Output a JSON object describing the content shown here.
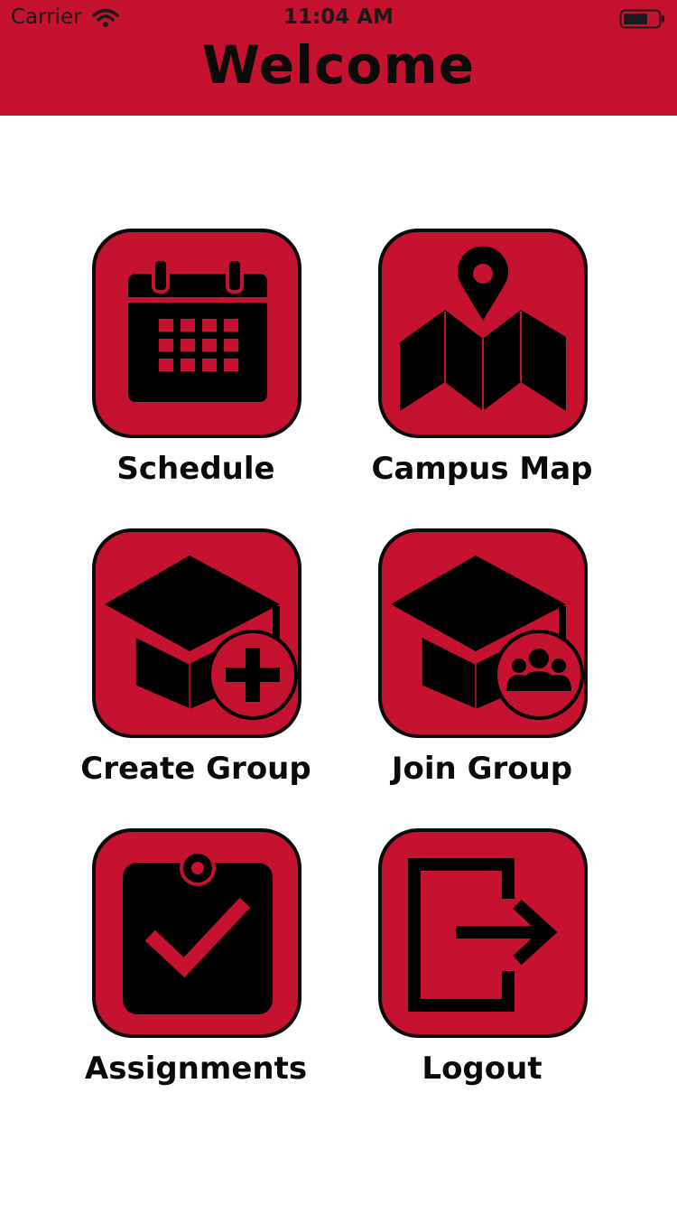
{
  "status_bar": {
    "carrier": "Carrier",
    "time": "11:04 AM",
    "wifi_icon": "wifi-icon",
    "battery_icon": "battery-icon"
  },
  "header": {
    "title": "Welcome",
    "background_color": "#c41230"
  },
  "menu": {
    "items": [
      {
        "label": "Schedule",
        "icon": "calendar-icon"
      },
      {
        "label": "Campus Map",
        "icon": "map-pin-icon"
      },
      {
        "label": "Create Group",
        "icon": "graduation-cap-plus-icon"
      },
      {
        "label": "Join Group",
        "icon": "graduation-cap-users-icon"
      },
      {
        "label": "Assignments",
        "icon": "clipboard-check-icon"
      },
      {
        "label": "Logout",
        "icon": "logout-icon"
      }
    ],
    "tile_color": "#c41230",
    "icon_color": "#000000"
  }
}
